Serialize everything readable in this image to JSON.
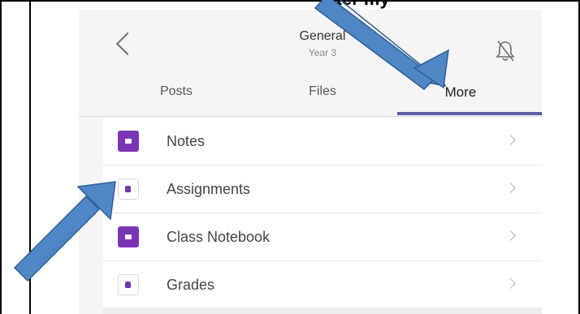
{
  "document": {
    "heading_fragment": "pter my"
  },
  "header": {
    "back_icon": "chevron-left-icon",
    "title": "General",
    "subtitle": "Year 3",
    "bell_icon": "bell-muted-icon"
  },
  "tabs": [
    {
      "label": "Posts",
      "active": false
    },
    {
      "label": "Files",
      "active": false
    },
    {
      "label": "More",
      "active": true
    }
  ],
  "menu": {
    "items": [
      {
        "label": "Notes",
        "icon": "onenote-app-icon"
      },
      {
        "label": "Assignments",
        "icon": "assignments-app-icon"
      },
      {
        "label": "Class Notebook",
        "icon": "class-notebook-app-icon"
      },
      {
        "label": "Grades",
        "icon": "grades-app-icon"
      }
    ]
  },
  "colors": {
    "accent": "#5b5fa8",
    "app_purple": "#7a35b5",
    "arrow_fill": "#4f86c6",
    "arrow_stroke": "#2f5f94"
  }
}
